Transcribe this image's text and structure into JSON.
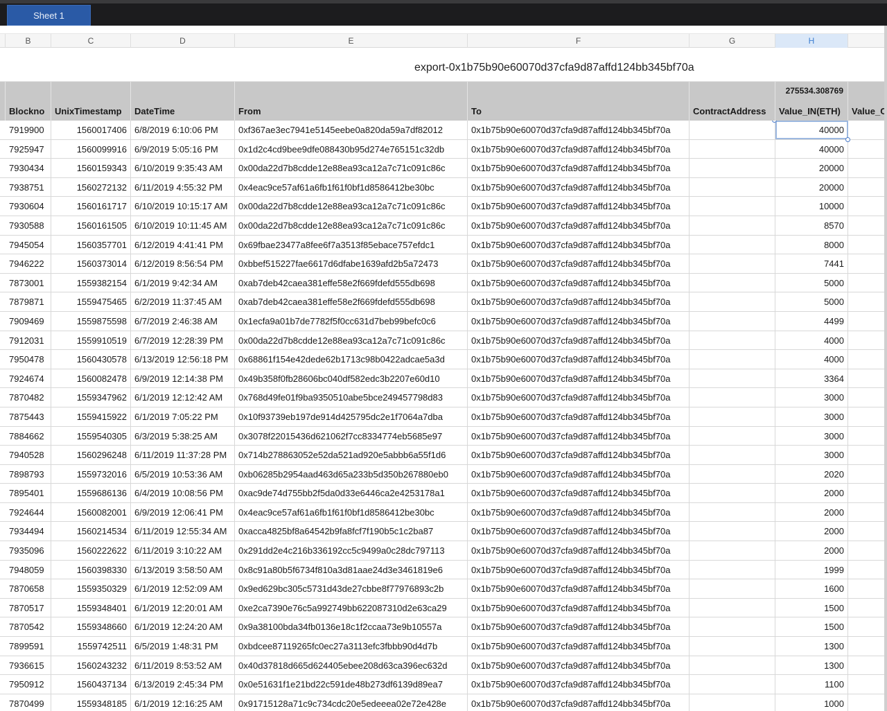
{
  "tabs": [
    {
      "label": "Sheet 1",
      "active": true
    }
  ],
  "column_letters": [
    "B",
    "C",
    "D",
    "E",
    "F",
    "G",
    "H"
  ],
  "selected_column": "H",
  "title": "export-0x1b75b90e60070d37cfa9d87affd124bb345bf70a",
  "sum_value": "275534.308769",
  "headers": [
    "Blockno",
    "UnixTimestamp",
    "DateTime",
    "From",
    "To",
    "ContractAddress",
    "Value_IN(ETH)",
    "Value_C"
  ],
  "rows": [
    [
      "7919900",
      "1560017406",
      "6/8/2019 6:10:06 PM",
      "0xf367ae3ec7941e5145eebe0a820da59a7df82012",
      "0x1b75b90e60070d37cfa9d87affd124bb345bf70a",
      "",
      "40000"
    ],
    [
      "7925947",
      "1560099916",
      "6/9/2019 5:05:16 PM",
      "0x1d2c4cd9bee9dfe088430b95d274e765151c32db",
      "0x1b75b90e60070d37cfa9d87affd124bb345bf70a",
      "",
      "40000"
    ],
    [
      "7930434",
      "1560159343",
      "6/10/2019 9:35:43 AM",
      "0x00da22d7b8cdde12e88ea93ca12a7c71c091c86c",
      "0x1b75b90e60070d37cfa9d87affd124bb345bf70a",
      "",
      "20000"
    ],
    [
      "7938751",
      "1560272132",
      "6/11/2019 4:55:32 PM",
      "0x4eac9ce57af61a6fb1f61f0bf1d8586412be30bc",
      "0x1b75b90e60070d37cfa9d87affd124bb345bf70a",
      "",
      "20000"
    ],
    [
      "7930604",
      "1560161717",
      "6/10/2019 10:15:17 AM",
      "0x00da22d7b8cdde12e88ea93ca12a7c71c091c86c",
      "0x1b75b90e60070d37cfa9d87affd124bb345bf70a",
      "",
      "10000"
    ],
    [
      "7930588",
      "1560161505",
      "6/10/2019 10:11:45 AM",
      "0x00da22d7b8cdde12e88ea93ca12a7c71c091c86c",
      "0x1b75b90e60070d37cfa9d87affd124bb345bf70a",
      "",
      "8570"
    ],
    [
      "7945054",
      "1560357701",
      "6/12/2019 4:41:41 PM",
      "0x69fbae23477a8fee6f7a3513f85ebace757efdc1",
      "0x1b75b90e60070d37cfa9d87affd124bb345bf70a",
      "",
      "8000"
    ],
    [
      "7946222",
      "1560373014",
      "6/12/2019 8:56:54 PM",
      "0xbbef515227fae6617d6dfabe1639afd2b5a72473",
      "0x1b75b90e60070d37cfa9d87affd124bb345bf70a",
      "",
      "7441"
    ],
    [
      "7873001",
      "1559382154",
      "6/1/2019 9:42:34 AM",
      "0xab7deb42caea381effe58e2f669fdefd555db698",
      "0x1b75b90e60070d37cfa9d87affd124bb345bf70a",
      "",
      "5000"
    ],
    [
      "7879871",
      "1559475465",
      "6/2/2019 11:37:45 AM",
      "0xab7deb42caea381effe58e2f669fdefd555db698",
      "0x1b75b90e60070d37cfa9d87affd124bb345bf70a",
      "",
      "5000"
    ],
    [
      "7909469",
      "1559875598",
      "6/7/2019 2:46:38 AM",
      "0x1ecfa9a01b7de7782f5f0cc631d7beb99befc0c6",
      "0x1b75b90e60070d37cfa9d87affd124bb345bf70a",
      "",
      "4499"
    ],
    [
      "7912031",
      "1559910519",
      "6/7/2019 12:28:39 PM",
      "0x00da22d7b8cdde12e88ea93ca12a7c71c091c86c",
      "0x1b75b90e60070d37cfa9d87affd124bb345bf70a",
      "",
      "4000"
    ],
    [
      "7950478",
      "1560430578",
      "6/13/2019 12:56:18 PM",
      "0x68861f154e42dede62b1713c98b0422adcae5a3d",
      "0x1b75b90e60070d37cfa9d87affd124bb345bf70a",
      "",
      "4000"
    ],
    [
      "7924674",
      "1560082478",
      "6/9/2019 12:14:38 PM",
      "0x49b358f0fb28606bc040df582edc3b2207e60d10",
      "0x1b75b90e60070d37cfa9d87affd124bb345bf70a",
      "",
      "3364"
    ],
    [
      "7870482",
      "1559347962",
      "6/1/2019 12:12:42 AM",
      "0x768d49fe01f9ba9350510abe5bce249457798d83",
      "0x1b75b90e60070d37cfa9d87affd124bb345bf70a",
      "",
      "3000"
    ],
    [
      "7875443",
      "1559415922",
      "6/1/2019 7:05:22 PM",
      "0x10f93739eb197de914d425795dc2e1f7064a7dba",
      "0x1b75b90e60070d37cfa9d87affd124bb345bf70a",
      "",
      "3000"
    ],
    [
      "7884662",
      "1559540305",
      "6/3/2019 5:38:25 AM",
      "0x3078f22015436d621062f7cc8334774eb5685e97",
      "0x1b75b90e60070d37cfa9d87affd124bb345bf70a",
      "",
      "3000"
    ],
    [
      "7940528",
      "1560296248",
      "6/11/2019 11:37:28 PM",
      "0x714b278863052e52da521ad920e5abbb6a55f1d6",
      "0x1b75b90e60070d37cfa9d87affd124bb345bf70a",
      "",
      "3000"
    ],
    [
      "7898793",
      "1559732016",
      "6/5/2019 10:53:36 AM",
      "0xb06285b2954aad463d65a233b5d350b267880eb0",
      "0x1b75b90e60070d37cfa9d87affd124bb345bf70a",
      "",
      "2020"
    ],
    [
      "7895401",
      "1559686136",
      "6/4/2019 10:08:56 PM",
      "0xac9de74d755bb2f5da0d33e6446ca2e4253178a1",
      "0x1b75b90e60070d37cfa9d87affd124bb345bf70a",
      "",
      "2000"
    ],
    [
      "7924644",
      "1560082001",
      "6/9/2019 12:06:41 PM",
      "0x4eac9ce57af61a6fb1f61f0bf1d8586412be30bc",
      "0x1b75b90e60070d37cfa9d87affd124bb345bf70a",
      "",
      "2000"
    ],
    [
      "7934494",
      "1560214534",
      "6/11/2019 12:55:34 AM",
      "0xacca4825bf8a64542b9fa8fcf7f190b5c1c2ba87",
      "0x1b75b90e60070d37cfa9d87affd124bb345bf70a",
      "",
      "2000"
    ],
    [
      "7935096",
      "1560222622",
      "6/11/2019 3:10:22 AM",
      "0x291dd2e4c216b336192cc5c9499a0c28dc797113",
      "0x1b75b90e60070d37cfa9d87affd124bb345bf70a",
      "",
      "2000"
    ],
    [
      "7948059",
      "1560398330",
      "6/13/2019 3:58:50 AM",
      "0x8c91a80b5f6734f810a3d81aae24d3e3461819e6",
      "0x1b75b90e60070d37cfa9d87affd124bb345bf70a",
      "",
      "1999"
    ],
    [
      "7870658",
      "1559350329",
      "6/1/2019 12:52:09 AM",
      "0x9ed629bc305c5731d43de27cbbe8f77976893c2b",
      "0x1b75b90e60070d37cfa9d87affd124bb345bf70a",
      "",
      "1600"
    ],
    [
      "7870517",
      "1559348401",
      "6/1/2019 12:20:01 AM",
      "0xe2ca7390e76c5a992749bb622087310d2e63ca29",
      "0x1b75b90e60070d37cfa9d87affd124bb345bf70a",
      "",
      "1500"
    ],
    [
      "7870542",
      "1559348660",
      "6/1/2019 12:24:20 AM",
      "0x9a38100bda34fb0136e18c1f2ccaa73e9b10557a",
      "0x1b75b90e60070d37cfa9d87affd124bb345bf70a",
      "",
      "1500"
    ],
    [
      "7899591",
      "1559742511",
      "6/5/2019 1:48:31 PM",
      "0xbdcee87119265fc0ec27a3113efc3fbbb90d4d7b",
      "0x1b75b90e60070d37cfa9d87affd124bb345bf70a",
      "",
      "1300"
    ],
    [
      "7936615",
      "1560243232",
      "6/11/2019 8:53:52 AM",
      "0x40d37818d665d624405ebee208d63ca396ec632d",
      "0x1b75b90e60070d37cfa9d87affd124bb345bf70a",
      "",
      "1300"
    ],
    [
      "7950912",
      "1560437134",
      "6/13/2019 2:45:34 PM",
      "0x0e51631f1e21bd22c591de48b273df6139d89ea7",
      "0x1b75b90e60070d37cfa9d87affd124bb345bf70a",
      "",
      "1100"
    ],
    [
      "7870499",
      "1559348185",
      "6/1/2019 12:16:25 AM",
      "0x91715128a71c9c734cdc20e5edeeea02e72e428e",
      "0x1b75b90e60070d37cfa9d87affd124bb345bf70a",
      "",
      "1000"
    ]
  ],
  "colors": {
    "tab_active": "#2a5aa6",
    "header_fill": "#c8c8c8",
    "selection": "#3d7fd1"
  }
}
